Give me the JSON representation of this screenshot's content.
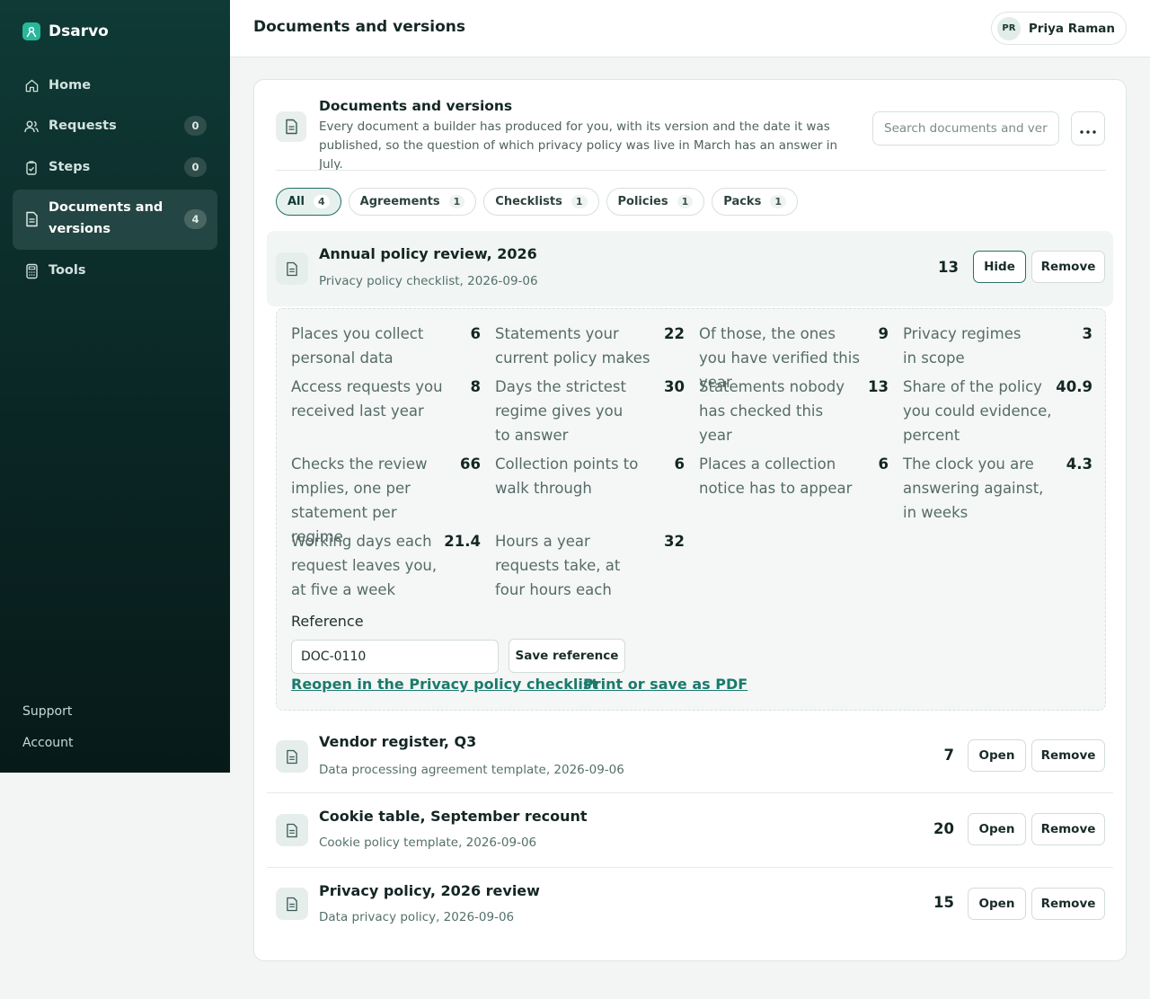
{
  "app": {
    "name": "Dsarvo",
    "page_title": "Documents and versions"
  },
  "sidebar": {
    "items": [
      {
        "label": "Home",
        "icon": "home-icon",
        "count": null
      },
      {
        "label": "Requests",
        "icon": "users-icon",
        "count": "0"
      },
      {
        "label": "Steps",
        "icon": "steps-icon",
        "count": "0"
      },
      {
        "label": "Documents and versions",
        "icon": "document-icon",
        "count": "4",
        "active": true
      },
      {
        "label": "Tools",
        "icon": "calculator-icon",
        "count": null
      }
    ],
    "footer": {
      "support": "Support",
      "account": "Account"
    }
  },
  "user": {
    "initials": "PR",
    "name": "Priya Raman"
  },
  "card": {
    "title": "Documents and versions",
    "description": "Every document a builder has produced for you, with its version and the date it was published, so the question of which privacy policy was live in March has an answer in July.",
    "search_placeholder": "Search documents and versions"
  },
  "filters": [
    {
      "label": "All",
      "count": "4",
      "active": true
    },
    {
      "label": "Agreements",
      "count": "1"
    },
    {
      "label": "Checklists",
      "count": "1"
    },
    {
      "label": "Policies",
      "count": "1"
    },
    {
      "label": "Packs",
      "count": "1"
    }
  ],
  "documents": [
    {
      "title": "Annual policy review, 2026",
      "subtitle": "Privacy policy checklist, 2026-09-06",
      "count": "13",
      "toggle_label": "Hide",
      "remove_label": "Remove",
      "expanded": true
    },
    {
      "title": "Vendor register, Q3",
      "subtitle": "Data processing agreement template, 2026-09-06",
      "count": "7",
      "toggle_label": "Open",
      "remove_label": "Remove"
    },
    {
      "title": "Cookie table, September recount",
      "subtitle": "Cookie policy template, 2026-09-06",
      "count": "20",
      "toggle_label": "Open",
      "remove_label": "Remove"
    },
    {
      "title": "Privacy policy, 2026 review",
      "subtitle": "Data privacy policy, 2026-09-06",
      "count": "15",
      "toggle_label": "Open",
      "remove_label": "Remove"
    }
  ],
  "details": {
    "stats": [
      {
        "label": "Places you collect personal data",
        "value": "6"
      },
      {
        "label": "Statements your current policy makes",
        "value": "22"
      },
      {
        "label": "Of those, the ones you have verified this year",
        "value": "9"
      },
      {
        "label": "Privacy regimes in scope",
        "value": "3"
      },
      {
        "label": "Access requests you received last year",
        "value": "8"
      },
      {
        "label": "Days the strictest regime gives you to answer",
        "value": "30"
      },
      {
        "label": "Statements nobody has checked this year",
        "value": "13"
      },
      {
        "label": "Share of the policy you could evidence, percent",
        "value": "40.9"
      },
      {
        "label": "Checks the review implies, one per statement per regime",
        "value": "66"
      },
      {
        "label": "Collection points to walk through",
        "value": "6"
      },
      {
        "label": "Places a collection notice has to appear",
        "value": "6"
      },
      {
        "label": "The clock you are answering against, in weeks",
        "value": "4.3"
      },
      {
        "label": "Working days each request leaves you, at five a week",
        "value": "21.4"
      },
      {
        "label": "Hours a year requests take, at four hours each",
        "value": "32"
      }
    ],
    "reference_label": "Reference",
    "reference_value": "DOC-0110",
    "save_reference": "Save reference",
    "reopen_link": "Reopen in the Privacy policy checklist",
    "print_link": "Print or save as PDF"
  },
  "colors": {
    "sidebar": "#0c2e2b",
    "accent": "#1b7a6c",
    "brand_logo": "#29b79c"
  }
}
